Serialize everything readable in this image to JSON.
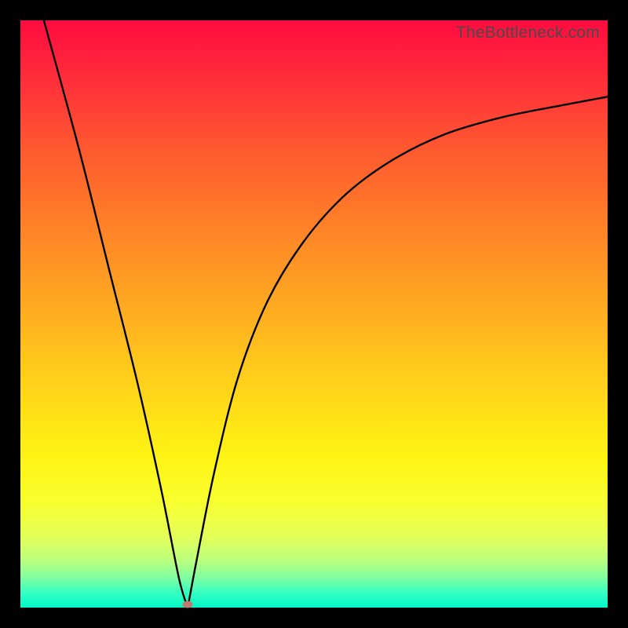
{
  "watermark": "TheBottleneck.com",
  "chart_data": {
    "type": "line",
    "title": "",
    "xlabel": "",
    "ylabel": "",
    "xlim": [
      0,
      100
    ],
    "ylim": [
      0,
      100
    ],
    "grid": false,
    "legend": false,
    "series": [
      {
        "name": "left-branch",
        "x": [
          4,
          10,
          15,
          20,
          24,
          27,
          28.5
        ],
        "y": [
          100,
          78,
          58,
          38,
          20,
          5,
          0
        ]
      },
      {
        "name": "right-branch",
        "x": [
          28.5,
          30,
          33,
          37,
          42,
          48,
          55,
          63,
          72,
          82,
          92,
          100
        ],
        "y": [
          0,
          8,
          23,
          39,
          52,
          62,
          70,
          76,
          80.5,
          83.5,
          85.5,
          87
        ]
      }
    ],
    "marker": {
      "x": 28.5,
      "y": 0.5,
      "color": "#c07a6f"
    },
    "background_gradient": {
      "top": "#ff0b40",
      "bottom": "#00f8c8"
    }
  }
}
